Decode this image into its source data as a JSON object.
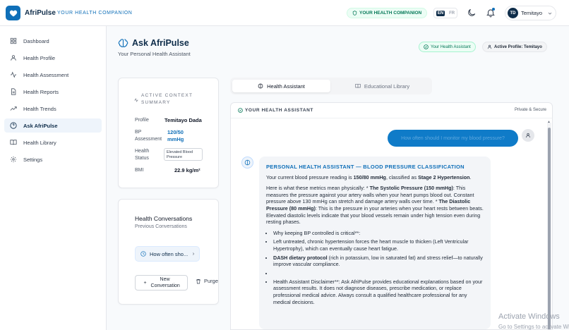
{
  "app": {
    "name": "AfriPulse",
    "tagline": "YOUR HEALTH COMPANION",
    "status_pill": "YOUR HEALTH COMPANION",
    "lang_active": "EN",
    "lang_other": "FR",
    "user_initials": "TD",
    "user_name": "Temitayo"
  },
  "sidebar": {
    "items": [
      {
        "label": "Dashboard",
        "icon": "grid-icon"
      },
      {
        "label": "Health Profile",
        "icon": "user-icon"
      },
      {
        "label": "Health Assessment",
        "icon": "activity-icon"
      },
      {
        "label": "Health Reports",
        "icon": "file-icon"
      },
      {
        "label": "Health Trends",
        "icon": "trend-icon"
      },
      {
        "label": "Ask AfriPulse",
        "icon": "help-circle-icon",
        "active": true
      },
      {
        "label": "Health Library",
        "icon": "book-icon"
      },
      {
        "label": "Settings",
        "icon": "gear-icon"
      }
    ]
  },
  "page": {
    "title": "Ask AfriPulse",
    "subtitle": "Your Personal Health Assistant",
    "badge_assistant": "Your Health Assistant",
    "badge_profile": "Active Profile: Temitayo"
  },
  "context": {
    "title": "ACTIVE CONTEXT SUMMARY",
    "profile_label": "Profile",
    "profile_value": "Temitayo Dada",
    "bp_label": "BP Assessment",
    "bp_value": "120/50 mmHg",
    "status_label": "Health Status",
    "status_value": "Elevated Blood Pressure",
    "bmi_label": "BMI",
    "bmi_value": "22.9 kg/m²"
  },
  "conversations": {
    "title": "Health Conversations",
    "subtitle": "Previous Conversations",
    "item": "How often sho...",
    "new_button": "New Conversation",
    "purge_button": "Purge"
  },
  "tabs": {
    "assistant": "Health Assistant",
    "library": "Educational Library"
  },
  "chat": {
    "header": "YOUR HEALTH ASSISTANT",
    "privacy": "Private & Secure",
    "user_message": "How often should I monitor my blood pressure?",
    "bot": {
      "title": "PERSONAL HEALTH ASSISTANT — BLOOD PRESSURE CLASSIFICATION",
      "p1_a": "Your current blood pressure reading is ",
      "p1_b": "150/80 mmHg",
      "p1_c": ", classified as ",
      "p1_d": "Stage 2 Hypertension",
      "p1_e": ".",
      "p2_a": "Here is what these metrics mean physically: * ",
      "p2_b": "The Systolic Pressure (150 mmHg)",
      "p2_c": ": This measures the pressure against your artery walls when your heart pumps blood out. Constant pressure above 130 mmHg can stretch and damage artery walls over time. * ",
      "p2_d": "The Diastolic Pressure (80 mmHg)",
      "p2_e": ": This is the pressure in your arteries when your heart rests between beats. Elevated diastolic levels indicate that your blood vessels remain under high tension even during resting phases.",
      "li1": "Why keeping BP controlled is critical**:",
      "li2": "Left untreated, chronic hypertension forces the heart muscle to thicken (Left Ventricular Hypertrophy), which can eventually cause heart fatigue.",
      "li3_a": "DASH dietary protocol",
      "li3_b": " (rich in potassium, low in saturated fat) and stress relief—to naturally improve vascular compliance.",
      "li4": "",
      "li5": "Health Assistant Disclaimer**: Ask AfriPulse provides educational explanations based on your assessment results. It does not diagnose diseases, prescribe medication, or replace professional medical advice. Always consult a qualified healthcare professional for any medical decisions."
    }
  },
  "watermark": {
    "line1": "Activate Windows",
    "line2": "Go to Settings to activate Windows."
  },
  "colors": {
    "brand": "#0f6fb8",
    "navy": "#0f2d4a",
    "green": "#047857"
  }
}
